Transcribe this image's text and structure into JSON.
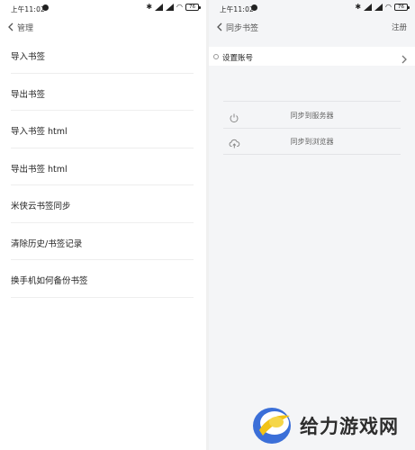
{
  "status_bar": {
    "time": "上午11:02",
    "battery": "76"
  },
  "left_screen": {
    "nav": {
      "title": "管理"
    },
    "menu": [
      {
        "label": "导入书签"
      },
      {
        "label": "导出书签"
      },
      {
        "label": "导入书签 html"
      },
      {
        "label": "导出书签 html"
      },
      {
        "label": "米侠云书签同步"
      },
      {
        "label": "清除历史/书签记录"
      },
      {
        "label": "换手机如何备份书签"
      }
    ]
  },
  "right_screen": {
    "nav": {
      "title": "同步书签",
      "action": "注册"
    },
    "account_label": "设置账号",
    "sync_options": [
      {
        "label": "同步到服务器",
        "icon": "power-icon"
      },
      {
        "label": "同步到浏览器",
        "icon": "cloud-icon"
      }
    ]
  },
  "watermark": {
    "text": "给力游戏网"
  },
  "colors": {
    "right_background": "#f4f5f7",
    "divider": "#eeeeee",
    "text": "#222222",
    "logo_blue": "#3b6fd8",
    "logo_yellow": "#f2c316"
  }
}
